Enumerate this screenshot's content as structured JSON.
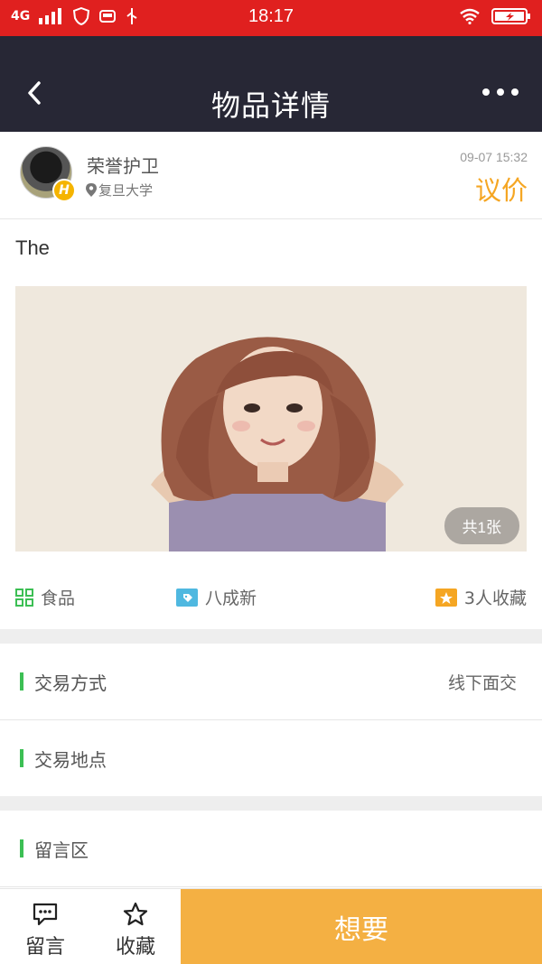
{
  "status_bar": {
    "network": "4G",
    "time": "18:17"
  },
  "header": {
    "title": "物品详情"
  },
  "seller": {
    "name": "荣誉护卫",
    "location": "复旦大学",
    "time": "09-07 15:32",
    "price": "议价",
    "badge": "H"
  },
  "item": {
    "description": "The",
    "photo_count": "共1张"
  },
  "tags": {
    "category": "食品",
    "condition": "八成新",
    "favorites": "3人收藏"
  },
  "details": {
    "trade_method_label": "交易方式",
    "trade_method_value": "线下面交",
    "trade_location_label": "交易地点",
    "comments_label": "留言区"
  },
  "bottom_bar": {
    "comment_label": "留言",
    "favorite_label": "收藏",
    "want_label": "想要"
  },
  "colors": {
    "status_bar": "#e0201f",
    "header": "#272735",
    "accent_orange": "#f5a623",
    "want_button": "#f4b043",
    "section_bar": "#3cbf54"
  },
  "icons": [
    "back-icon",
    "more-icon",
    "location-pin-icon",
    "grid-category-icon",
    "tag-icon",
    "star-box-icon",
    "chat-bubble-icon",
    "star-outline-icon",
    "signal-icon",
    "wifi-icon",
    "battery-icon",
    "shield-icon",
    "usb-icon"
  ]
}
